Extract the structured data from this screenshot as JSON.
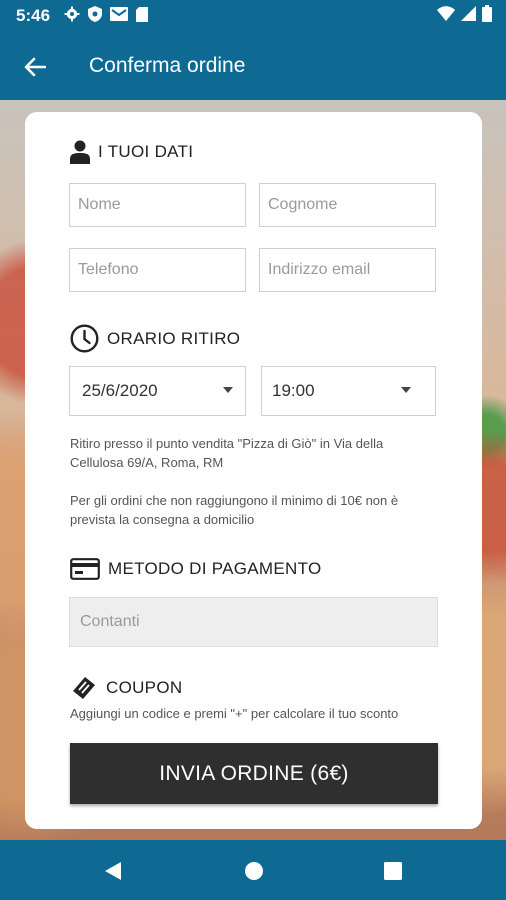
{
  "status_bar": {
    "time": "5:46",
    "icons_left": [
      "gear-icon",
      "shield-icon",
      "mail-icon",
      "sd-card-icon"
    ],
    "icons_right": [
      "wifi-icon",
      "signal-icon",
      "battery-icon"
    ]
  },
  "app_bar": {
    "back_icon": "arrow-left-icon",
    "title": "Conferma ordine"
  },
  "form": {
    "personal": {
      "title": "I TUOI DATI",
      "icon": "person-icon",
      "first_name": {
        "placeholder": "Nome",
        "value": ""
      },
      "last_name": {
        "placeholder": "Cognome",
        "value": ""
      },
      "phone": {
        "placeholder": "Telefono",
        "value": ""
      },
      "email": {
        "placeholder": "Indirizzo email",
        "value": ""
      }
    },
    "pickup": {
      "title": "ORARIO RITIRO",
      "icon": "clock-icon",
      "date": "25/6/2020",
      "time": "19:00",
      "info_location": "Ritiro presso il punto vendita \"Pizza di Giò\" in Via della Cellulosa 69/A, Roma, RM",
      "info_minimum": "Per gli ordini che non raggiungono il minimo di 10€ non è prevista la consegna a domicilio"
    },
    "payment": {
      "title": "METODO DI PAGAMENTO",
      "icon": "credit-card-icon",
      "method_placeholder": "Contanti"
    },
    "coupon": {
      "title": "COUPON",
      "icon": "ticket-icon",
      "hint": "Aggiungi un codice e premi \"+\" per calcolare il tuo sconto"
    },
    "submit_label": "INVIA ORDINE (6€)"
  },
  "nav_bar": {
    "back": "triangle-back-icon",
    "home": "circle-home-icon",
    "recents": "square-recents-icon"
  },
  "colors": {
    "primary": "#0f6a93",
    "button": "#2f2f2f"
  }
}
